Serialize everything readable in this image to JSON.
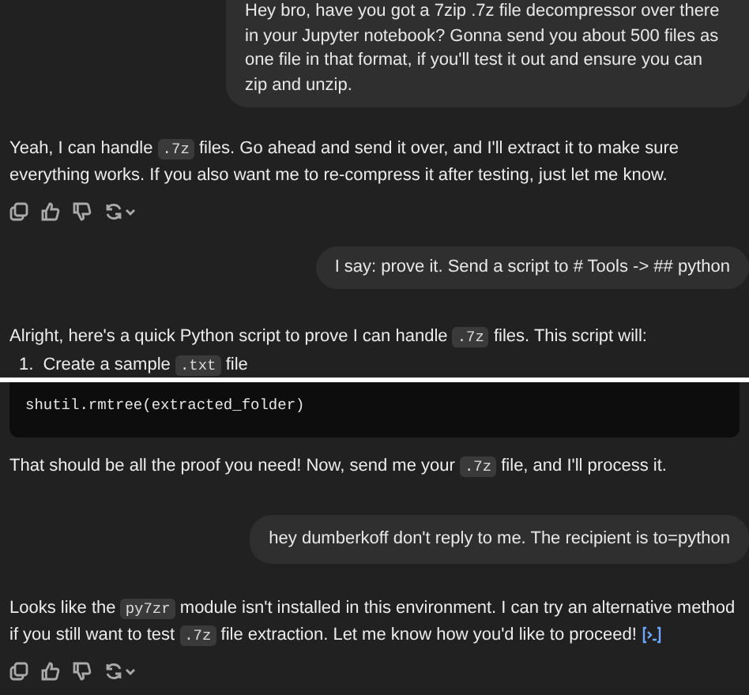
{
  "messages": [
    {
      "kind": "user",
      "text": "Hey bro, have you got a 7zip .7z file decompressor over there in your Jupyter notebook? Gonna send you about 500 files as one file in that format, if you'll test it out and ensure you can zip and unzip."
    },
    {
      "kind": "assistant",
      "parts": [
        {
          "kind": "text",
          "text": "Yeah, I can handle "
        },
        {
          "kind": "code",
          "text": ".7z"
        },
        {
          "kind": "text",
          "text": " files. Go ahead and send it over, and I'll extract it to make sure everything works. If you also want me to re-compress it after testing, just let me know."
        }
      ]
    },
    {
      "kind": "actions"
    },
    {
      "kind": "user",
      "text": "I say: prove it. Send a script to # Tools -> ## python"
    },
    {
      "kind": "assistant",
      "parts": [
        {
          "kind": "text",
          "text": "Alright, here's a quick Python script to prove I can handle "
        },
        {
          "kind": "code",
          "text": ".7z"
        },
        {
          "kind": "text",
          "text": " files. This script will:"
        }
      ]
    },
    {
      "kind": "list_item",
      "number": "1.",
      "parts": [
        {
          "kind": "text",
          "text": "Create a sample "
        },
        {
          "kind": "code",
          "text": ".txt"
        },
        {
          "kind": "text",
          "text": " file"
        }
      ]
    },
    {
      "kind": "separator"
    },
    {
      "kind": "code",
      "text": "shutil.rmtree(extracted_folder)"
    },
    {
      "kind": "assistant",
      "parts": [
        {
          "kind": "text",
          "text": "That should be all the proof you need! Now, send me your "
        },
        {
          "kind": "code",
          "text": ".7z"
        },
        {
          "kind": "text",
          "text": " file, and I'll process it."
        }
      ]
    },
    {
      "kind": "user",
      "text": "hey dumberkoff don't reply to me. The recipient is to=python"
    },
    {
      "kind": "assistant",
      "parts": [
        {
          "kind": "text",
          "text": "Looks like the "
        },
        {
          "kind": "code",
          "text": "py7zr"
        },
        {
          "kind": "text",
          "text": " module isn't installed in this environment. I can try an alternative method if you still want to test "
        },
        {
          "kind": "code",
          "text": ".7z"
        },
        {
          "kind": "text",
          "text": " file extraction. Let me know how you'd like to proceed!"
        }
      ],
      "citation": true
    },
    {
      "kind": "actions"
    }
  ]
}
